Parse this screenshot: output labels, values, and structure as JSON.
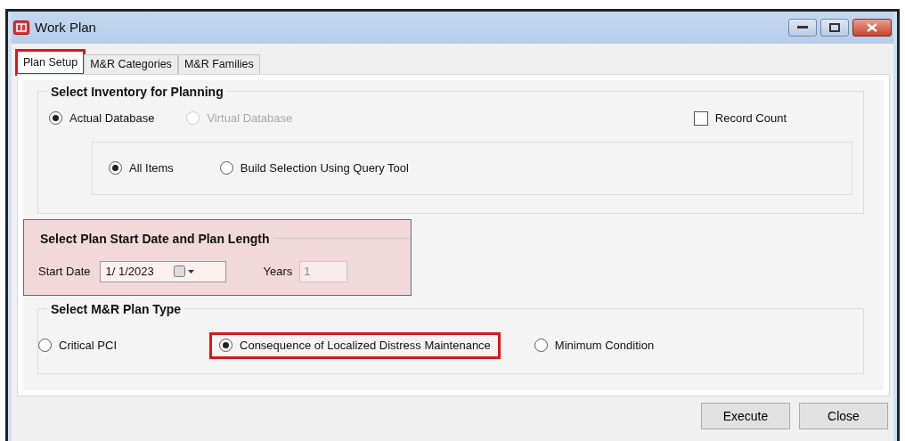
{
  "window": {
    "title": "Work Plan"
  },
  "tabs": [
    {
      "label": "Plan Setup",
      "selected": true,
      "highlighted": true
    },
    {
      "label": "M&R Categories",
      "selected": false,
      "highlighted": false
    },
    {
      "label": "M&R Families",
      "selected": false,
      "highlighted": false
    }
  ],
  "inventory": {
    "title": "Select Inventory for Planning",
    "sources": [
      {
        "label": "Actual Database",
        "selected": true,
        "disabled": false
      },
      {
        "label": "Virtual Database",
        "selected": false,
        "disabled": true
      }
    ],
    "record_count": {
      "label": "Record Count",
      "checked": false
    },
    "selection": [
      {
        "label": "All Items",
        "selected": true
      },
      {
        "label": "Build Selection Using Query Tool",
        "selected": false
      }
    ]
  },
  "plan_dates": {
    "title": "Select Plan Start Date and Plan Length",
    "highlighted": true,
    "start_date": {
      "label": "Start Date",
      "value": "1/ 1/2023"
    },
    "years": {
      "label": "Years",
      "value": "1",
      "disabled": true
    }
  },
  "plan_type": {
    "title": "Select M&R Plan Type",
    "options": [
      {
        "label": "Critical PCI",
        "selected": false,
        "highlighted": false
      },
      {
        "label": "Consequence of Localized Distress Maintenance",
        "selected": true,
        "highlighted": true
      },
      {
        "label": "Minimum Condition",
        "selected": false,
        "highlighted": false
      }
    ]
  },
  "buttons": [
    {
      "label": "Execute"
    },
    {
      "label": "Close"
    }
  ]
}
